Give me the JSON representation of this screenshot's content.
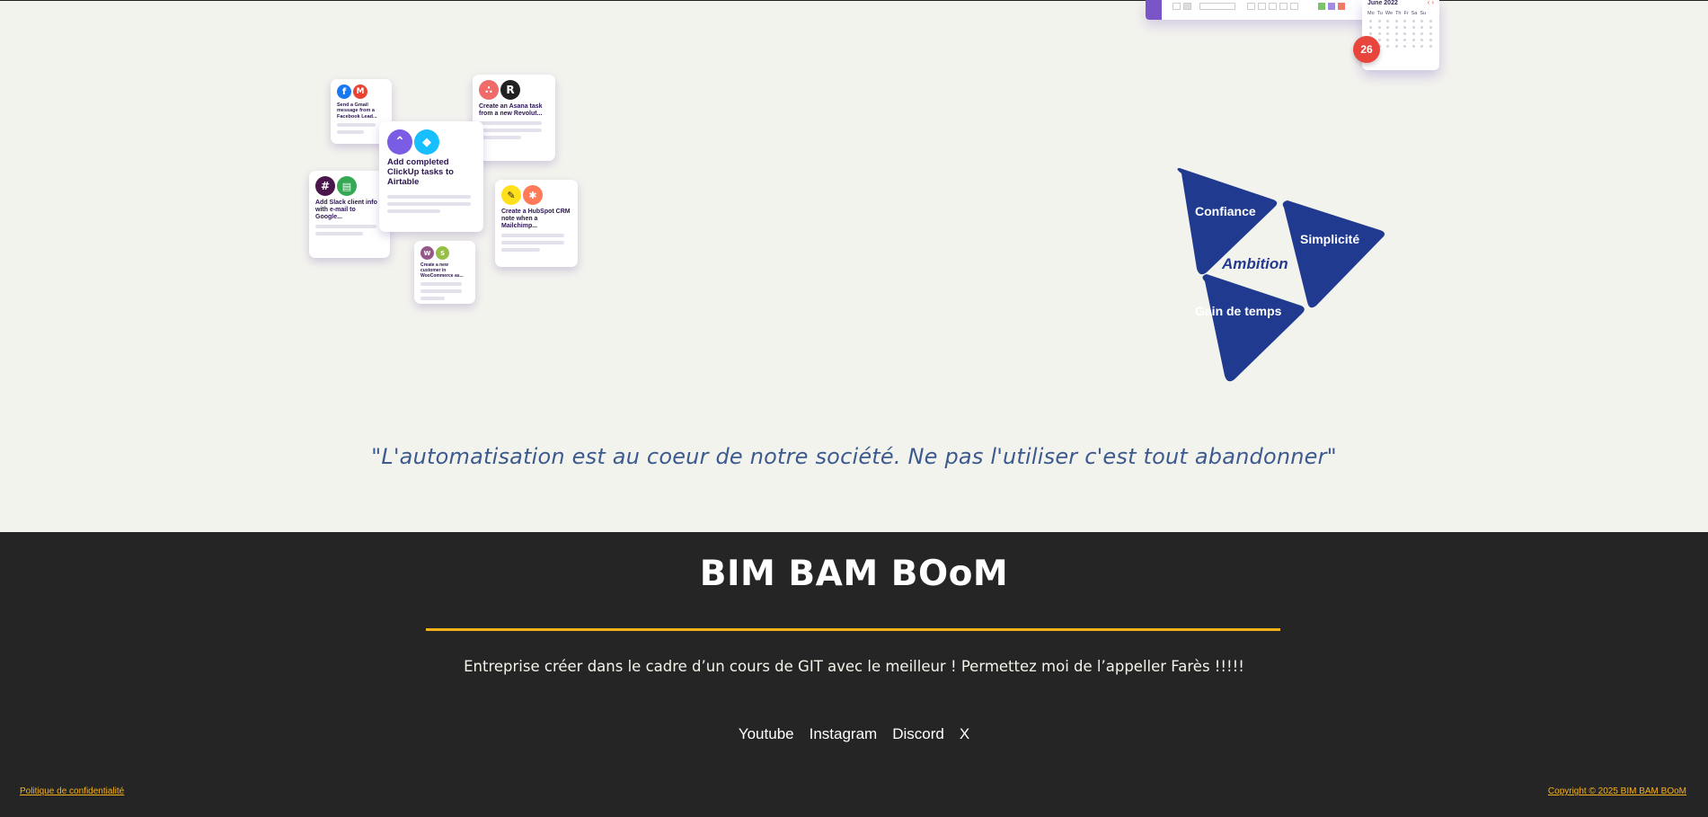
{
  "collage": {
    "cards": [
      {
        "title": "Send a Gmail message from a Facebook Lead...",
        "icons": [
          "facebook-icon",
          "gmail-icon"
        ]
      },
      {
        "title": "Create an Asana task from a new Revolut...",
        "icons": [
          "asana-icon",
          "revolut-icon"
        ]
      },
      {
        "title": "Add completed ClickUp tasks to Airtable",
        "icons": [
          "clickup-icon",
          "airtable-icon"
        ]
      },
      {
        "title": "Add Slack client info with e-mail to Google...",
        "icons": [
          "slack-icon",
          "google-sheets-icon"
        ]
      },
      {
        "title": "Create a HubSpot CRM note when a Mailchimp...",
        "icons": [
          "mailchimp-icon",
          "hubspot-icon"
        ]
      },
      {
        "title": "Create a new customer in WooCommerce as...",
        "icons": [
          "woocommerce-icon",
          "shopify-icon"
        ]
      }
    ]
  },
  "calendar": {
    "month": "June 2022",
    "days": [
      "Mo",
      "Tu",
      "We",
      "Th",
      "Fr",
      "Sa",
      "Su"
    ],
    "badge": "26"
  },
  "values": {
    "confiance": "Confiance",
    "simplicite": "Simplicité",
    "gain": "Gain de temps",
    "ambition": "Ambition",
    "color": "#1f3a8f"
  },
  "quote": "\"L'automatisation est au coeur de notre société. Ne pas l'utiliser c'est tout abandonner\"",
  "footer": {
    "brand": "BIM BAM BOoM",
    "tagline": "Entreprise créer dans le cadre d’un cours de GIT avec le meilleur ! Permettez moi de l’appeller Farès !!!!!",
    "socials": {
      "youtube": "Youtube",
      "instagram": "Instagram",
      "discord": "Discord",
      "x": "X"
    },
    "privacy": "Politique de confidentialité",
    "copyright": "Copyright © 2025 BIM BAM BOoM",
    "accent": "#f5b11c",
    "background": "#252525"
  }
}
